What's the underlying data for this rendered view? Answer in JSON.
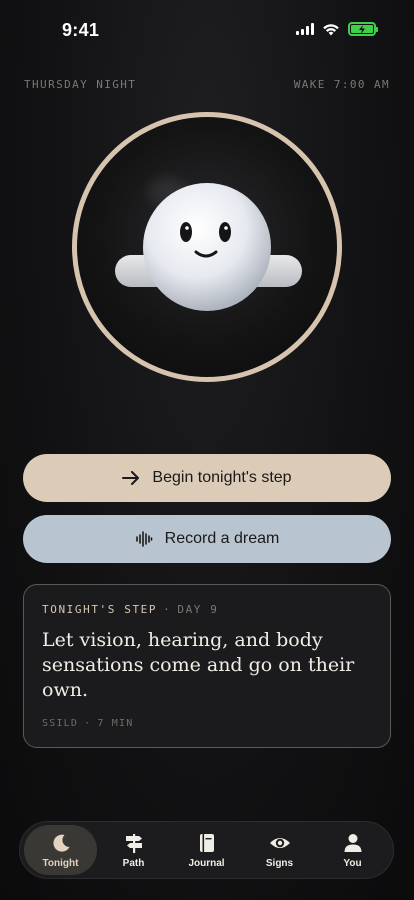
{
  "status_bar": {
    "time": "9:41"
  },
  "header": {
    "left": "THURSDAY NIGHT",
    "right": "WAKE 7:00 AM"
  },
  "buttons": {
    "primary": {
      "label": "Begin tonight's step",
      "icon": "arrow-right-icon"
    },
    "secondary": {
      "label": "Record a dream",
      "icon": "waveform-icon"
    }
  },
  "card": {
    "eyebrow": "TONIGHT'S STEP",
    "separator": "·",
    "day": "DAY 9",
    "body": "Let vision, hearing, and body sensations come and go on their own.",
    "technique": "SSILD",
    "duration": "7 MIN"
  },
  "tabs": [
    {
      "label": "Tonight",
      "icon": "moon-icon",
      "active": true
    },
    {
      "label": "Path",
      "icon": "signpost-icon",
      "active": false
    },
    {
      "label": "Journal",
      "icon": "book-icon",
      "active": false
    },
    {
      "label": "Signs",
      "icon": "eye-icon",
      "active": false
    },
    {
      "label": "You",
      "icon": "person-icon",
      "active": false
    }
  ],
  "colors": {
    "accent": "#dccbb7",
    "secondary": "#b8c4cf",
    "ring": "#d6c4ae",
    "battery": "#3fcf4a"
  }
}
